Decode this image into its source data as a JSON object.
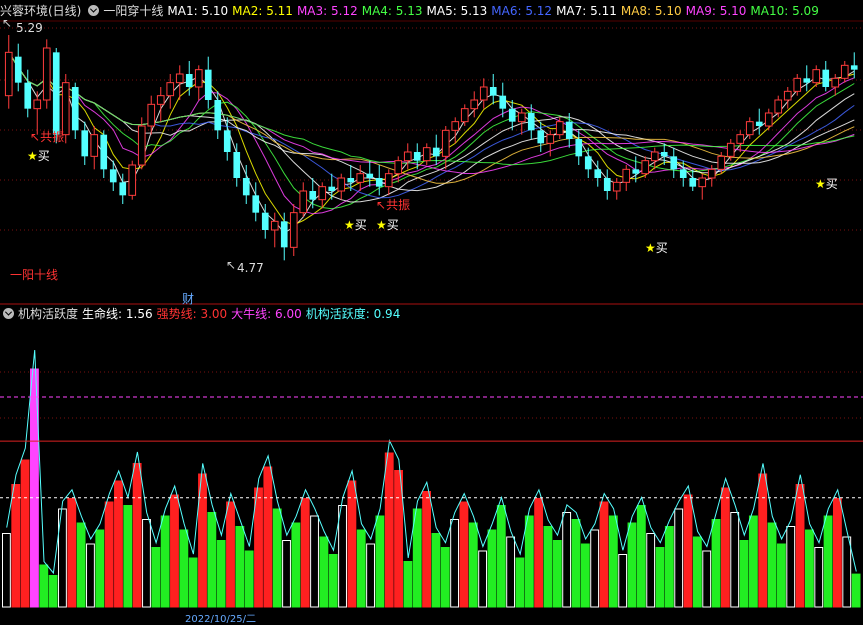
{
  "upper": {
    "title": "兴蓉环境(日线)",
    "indicator": "一阳穿十线",
    "ma": [
      {
        "label": "MA1: 5.10",
        "color": "#ffffff"
      },
      {
        "label": "MA2: 5.11",
        "color": "#ffff00"
      },
      {
        "label": "MA3: 5.12",
        "color": "#ff44ff"
      },
      {
        "label": "MA4: 5.13",
        "color": "#44ff44"
      },
      {
        "label": "MA5: 5.13",
        "color": "#ffffff"
      },
      {
        "label": "MA6: 5.12",
        "color": "#4466ff"
      },
      {
        "label": "MA7: 5.11",
        "color": "#ffffff"
      },
      {
        "label": "MA8: 5.10",
        "color": "#ffcc44"
      },
      {
        "label": "MA9: 5.10",
        "color": "#ff44ff"
      },
      {
        "label": "MA10: 5.09",
        "color": "#44ff44"
      }
    ],
    "high_label": "5.29",
    "low_label": "4.77",
    "signal_label": "一阳十线",
    "gongzhen": "共振",
    "buy": "买",
    "cai": "财"
  },
  "lower": {
    "title": "机构活跃度",
    "values": [
      {
        "label": "生命线: 1.56",
        "color": "#ffffff"
      },
      {
        "label": "强势线: 3.00",
        "color": "#ff3333"
      },
      {
        "label": "大牛线: 6.00",
        "color": "#ff44ff"
      },
      {
        "label": "机构活跃度: 0.94",
        "color": "#55ffff"
      }
    ]
  },
  "xaxis": {
    "date": "2022/10/25/二"
  },
  "chart_data": [
    {
      "type": "candlestick",
      "title": "兴蓉环境(日线)",
      "annotations": [
        "5.29",
        "4.77",
        "共振",
        "买",
        "一阳十线",
        "财"
      ],
      "ohlc": [
        [
          5.15,
          5.29,
          5.12,
          5.25
        ],
        [
          5.24,
          5.27,
          5.16,
          5.18
        ],
        [
          5.18,
          5.21,
          5.1,
          5.12
        ],
        [
          5.12,
          5.16,
          5.06,
          5.14
        ],
        [
          5.14,
          5.28,
          5.12,
          5.26
        ],
        [
          5.25,
          5.26,
          5.04,
          5.06
        ],
        [
          5.06,
          5.2,
          5.04,
          5.18
        ],
        [
          5.17,
          5.18,
          5.05,
          5.07
        ],
        [
          5.07,
          5.09,
          4.99,
          5.01
        ],
        [
          5.01,
          5.08,
          4.98,
          5.06
        ],
        [
          5.06,
          5.07,
          4.96,
          4.98
        ],
        [
          4.98,
          5.0,
          4.93,
          4.95
        ],
        [
          4.95,
          4.97,
          4.9,
          4.92
        ],
        [
          4.92,
          5.0,
          4.91,
          4.99
        ],
        [
          4.99,
          5.1,
          4.98,
          5.08
        ],
        [
          5.08,
          5.15,
          5.06,
          5.13
        ],
        [
          5.13,
          5.17,
          5.09,
          5.15
        ],
        [
          5.15,
          5.2,
          5.12,
          5.18
        ],
        [
          5.18,
          5.22,
          5.14,
          5.2
        ],
        [
          5.2,
          5.23,
          5.15,
          5.17
        ],
        [
          5.17,
          5.22,
          5.14,
          5.21
        ],
        [
          5.21,
          5.24,
          5.12,
          5.14
        ],
        [
          5.14,
          5.16,
          5.05,
          5.07
        ],
        [
          5.07,
          5.1,
          5.0,
          5.02
        ],
        [
          5.02,
          5.04,
          4.94,
          4.96
        ],
        [
          4.96,
          4.99,
          4.9,
          4.92
        ],
        [
          4.92,
          4.95,
          4.86,
          4.88
        ],
        [
          4.88,
          4.9,
          4.82,
          4.84
        ],
        [
          4.84,
          4.88,
          4.8,
          4.86
        ],
        [
          4.86,
          4.88,
          4.77,
          4.8
        ],
        [
          4.8,
          4.9,
          4.78,
          4.88
        ],
        [
          4.88,
          4.95,
          4.87,
          4.93
        ],
        [
          4.93,
          4.96,
          4.89,
          4.91
        ],
        [
          4.91,
          4.95,
          4.89,
          4.94
        ],
        [
          4.94,
          4.97,
          4.91,
          4.93
        ],
        [
          4.93,
          4.97,
          4.91,
          4.96
        ],
        [
          4.96,
          4.99,
          4.93,
          4.95
        ],
        [
          4.95,
          4.99,
          4.93,
          4.97
        ],
        [
          4.97,
          5.0,
          4.94,
          4.96
        ],
        [
          4.96,
          4.99,
          4.92,
          4.94
        ],
        [
          4.94,
          4.98,
          4.92,
          4.97
        ],
        [
          4.97,
          5.01,
          4.95,
          5.0
        ],
        [
          5.0,
          5.04,
          4.98,
          5.02
        ],
        [
          5.02,
          5.04,
          4.98,
          5.0
        ],
        [
          5.0,
          5.04,
          4.99,
          5.03
        ],
        [
          5.03,
          5.06,
          4.99,
          5.01
        ],
        [
          5.01,
          5.08,
          4.98,
          5.07
        ],
        [
          5.07,
          5.1,
          5.04,
          5.09
        ],
        [
          5.09,
          5.13,
          5.08,
          5.12
        ],
        [
          5.12,
          5.16,
          5.1,
          5.14
        ],
        [
          5.14,
          5.19,
          5.12,
          5.17
        ],
        [
          5.17,
          5.2,
          5.13,
          5.15
        ],
        [
          5.15,
          5.18,
          5.1,
          5.12
        ],
        [
          5.12,
          5.14,
          5.07,
          5.09
        ],
        [
          5.09,
          5.12,
          5.06,
          5.11
        ],
        [
          5.11,
          5.13,
          5.05,
          5.07
        ],
        [
          5.07,
          5.09,
          5.02,
          5.04
        ],
        [
          5.04,
          5.07,
          5.01,
          5.06
        ],
        [
          5.06,
          5.1,
          5.05,
          5.09
        ],
        [
          5.09,
          5.11,
          5.03,
          5.05
        ],
        [
          5.05,
          5.07,
          4.99,
          5.01
        ],
        [
          5.01,
          5.03,
          4.96,
          4.98
        ],
        [
          4.98,
          5.0,
          4.94,
          4.96
        ],
        [
          4.96,
          4.98,
          4.91,
          4.93
        ],
        [
          4.93,
          4.96,
          4.91,
          4.95
        ],
        [
          4.95,
          4.99,
          4.93,
          4.98
        ],
        [
          4.98,
          5.01,
          4.95,
          4.97
        ],
        [
          4.97,
          5.01,
          4.96,
          5.0
        ],
        [
          5.0,
          5.03,
          4.98,
          5.02
        ],
        [
          5.02,
          5.04,
          4.99,
          5.01
        ],
        [
          5.01,
          5.03,
          4.96,
          4.98
        ],
        [
          4.98,
          5.0,
          4.94,
          4.96
        ],
        [
          4.96,
          4.98,
          4.93,
          4.94
        ],
        [
          4.94,
          4.97,
          4.91,
          4.96
        ],
        [
          4.96,
          4.99,
          4.94,
          4.98
        ],
        [
          4.98,
          5.02,
          4.97,
          5.01
        ],
        [
          5.01,
          5.05,
          5.0,
          5.04
        ],
        [
          5.04,
          5.07,
          5.02,
          5.06
        ],
        [
          5.06,
          5.1,
          5.05,
          5.09
        ],
        [
          5.09,
          5.12,
          5.06,
          5.08
        ],
        [
          5.08,
          5.12,
          5.07,
          5.11
        ],
        [
          5.11,
          5.15,
          5.1,
          5.14
        ],
        [
          5.14,
          5.17,
          5.12,
          5.16
        ],
        [
          5.16,
          5.2,
          5.15,
          5.19
        ],
        [
          5.19,
          5.22,
          5.16,
          5.18
        ],
        [
          5.18,
          5.22,
          5.17,
          5.21
        ],
        [
          5.21,
          5.23,
          5.16,
          5.17
        ],
        [
          5.17,
          5.2,
          5.15,
          5.19
        ],
        [
          5.19,
          5.23,
          5.18,
          5.22
        ],
        [
          5.22,
          5.25,
          5.19,
          5.21
        ]
      ]
    },
    {
      "type": "bar",
      "title": "机构活跃度",
      "series": [
        {
          "name": "生命线",
          "values": [
            1.56
          ]
        },
        {
          "name": "强势线",
          "values": [
            3.0
          ]
        },
        {
          "name": "大牛线",
          "values": [
            6.0
          ]
        },
        {
          "name": "机构活跃度",
          "values": [
            2.1,
            3.5,
            4.2,
            6.8,
            1.2,
            0.9,
            2.8,
            3.1,
            2.4,
            1.8,
            2.2,
            3.0,
            3.6,
            2.9,
            4.1,
            2.5,
            1.7,
            2.6,
            3.2,
            2.2,
            1.4,
            3.8,
            2.7,
            1.9,
            3.0,
            2.3,
            1.6,
            3.4,
            4.0,
            2.8,
            1.9,
            2.4,
            3.1,
            2.6,
            2.0,
            1.5,
            2.9,
            3.6,
            2.2,
            1.8,
            2.6,
            4.4,
            3.9,
            1.3,
            2.8,
            3.3,
            2.1,
            1.7,
            2.5,
            3.0,
            2.4,
            1.6,
            2.2,
            2.9,
            2.0,
            1.4,
            2.6,
            3.1,
            2.3,
            1.9,
            2.7,
            2.5,
            1.8,
            2.2,
            3.0,
            2.6,
            1.5,
            2.4,
            2.9,
            2.1,
            1.7,
            2.3,
            2.8,
            3.2,
            2.0,
            1.6,
            2.5,
            3.4,
            2.7,
            1.9,
            2.6,
            3.8,
            2.4,
            1.8,
            2.3,
            3.5,
            2.2,
            1.7,
            2.6,
            3.1,
            2.0,
            0.94
          ]
        }
      ]
    }
  ]
}
